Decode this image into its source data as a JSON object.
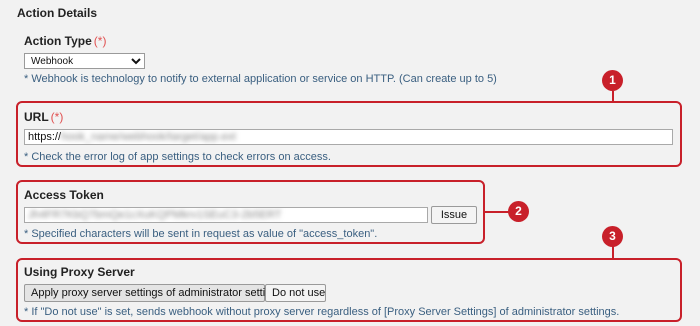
{
  "section": {
    "title": "Action Details"
  },
  "action_type": {
    "label": "Action Type",
    "required_mark": "(*)",
    "selected": "Webhook",
    "note": "* Webhook is technology to notify to external application or service on HTTP. (Can create up to 5)"
  },
  "url": {
    "label": "URL",
    "required_mark": "(*)",
    "value_prefix": "https://",
    "value_obscured": "hook_name/webhook/target/app.ext",
    "note": "* Check the error log of app settings to check errors on access."
  },
  "access_token": {
    "label": "Access Token",
    "value_obscured": "Jh4FR7KbQ7bmQe1cXuKQPMkrv1SEuC3-2b5ERT",
    "issue_button": "Issue",
    "note": "* Specified characters will be sent in request as value of \"access_token\"."
  },
  "proxy": {
    "label": "Using Proxy Server",
    "option_admin": "Apply proxy server settings of administrator settings",
    "option_none": "Do not use",
    "note": "* If \"Do not use\" is set, sends webhook without proxy server regardless of [Proxy Server Settings] of administrator settings."
  },
  "callouts": {
    "one": "1",
    "two": "2",
    "three": "3"
  },
  "colors": {
    "callout": "#c8202a",
    "note_text": "#3a5f80",
    "required": "#e05050"
  }
}
